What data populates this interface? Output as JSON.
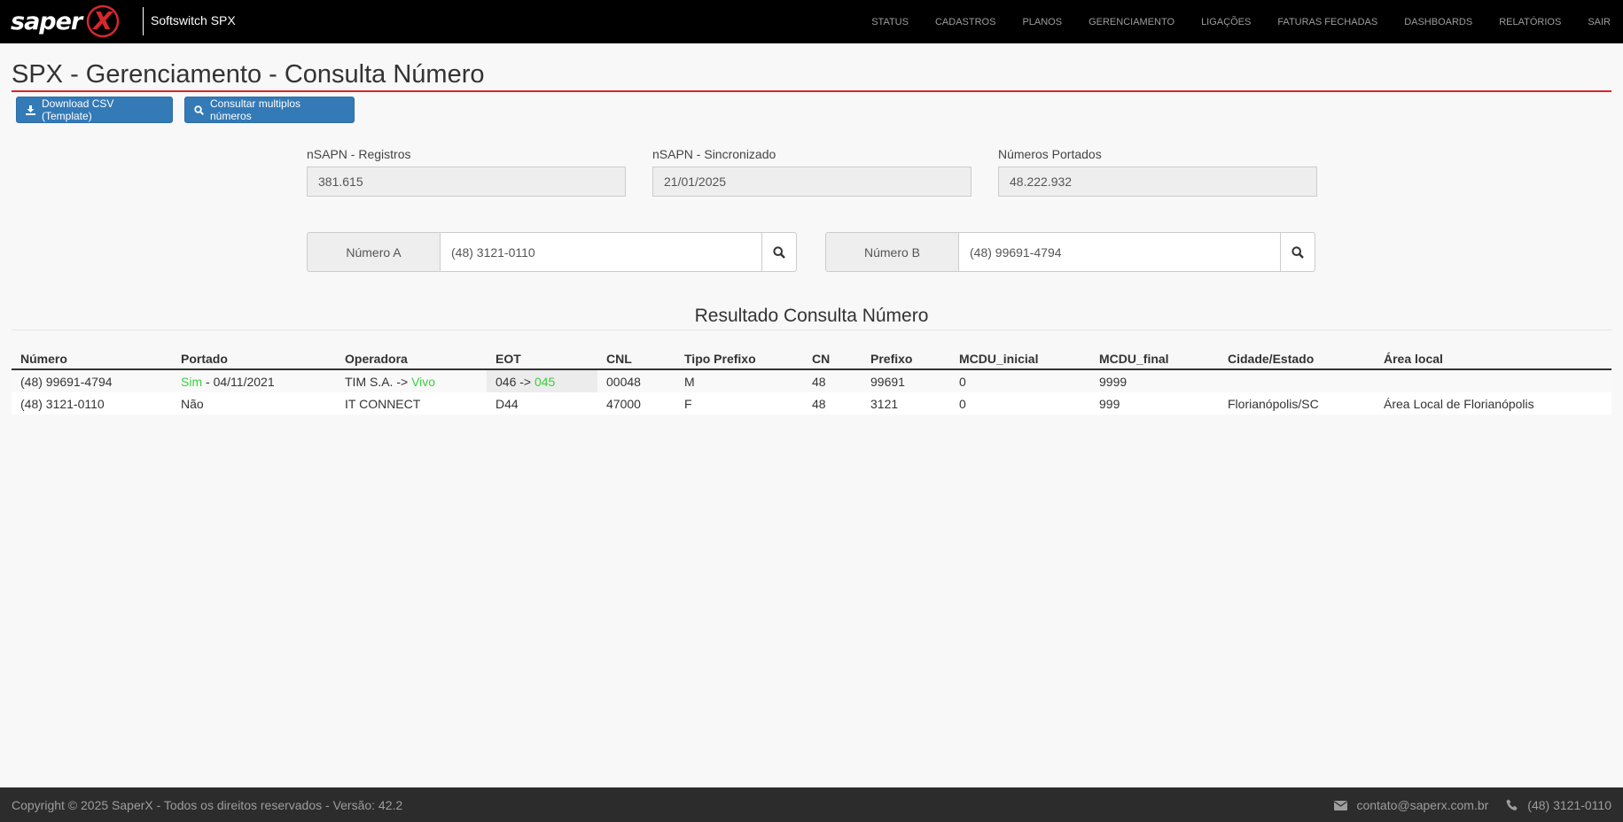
{
  "nav": {
    "logo_text": "saper",
    "logo_mark": "X",
    "brand": "Softswitch SPX",
    "items": [
      "STATUS",
      "CADASTROS",
      "PLANOS",
      "GERENCIAMENTO",
      "LIGAÇÕES",
      "FATURAS FECHADAS",
      "DASHBOARDS",
      "RELATÓRIOS",
      "SAIR"
    ]
  },
  "page": {
    "title": "SPX - Gerenciamento - Consulta Número",
    "accent_color": "#d9262d"
  },
  "buttons": {
    "download_csv": "Download CSV (Template)",
    "consultar_multiplos": "Consultar multiplos números"
  },
  "stats": {
    "registros_label": "nSAPN - Registros",
    "registros_value": "381.615",
    "sincronizado_label": "nSAPN - Sincronizado",
    "sincronizado_value": "21/01/2025",
    "portados_label": "Números Portados",
    "portados_value": "48.222.932"
  },
  "search": {
    "a_label": "Número A",
    "a_value": "(48) 3121-0110",
    "b_label": "Número B",
    "b_value": "(48) 99691-4794"
  },
  "results": {
    "title": "Resultado Consulta Número",
    "headers": [
      "Número",
      "Portado",
      "Operadora",
      "EOT",
      "CNL",
      "Tipo Prefixo",
      "CN",
      "Prefixo",
      "MCDU_inicial",
      "MCDU_final",
      "Cidade/Estado",
      "Área local"
    ],
    "rows": [
      {
        "numero": "(48) 99691-4794",
        "portado_flag": "Sim",
        "portado_sep": " - ",
        "portado_date": "04/11/2021",
        "operadora_from": "TIM S.A. -> ",
        "operadora_to": "Vivo",
        "eot_from": "046 -> ",
        "eot_to": "045",
        "cnl": "00048",
        "tipo_prefixo": "M",
        "cn": "48",
        "prefixo": "99691",
        "mcdu_inicial": "0",
        "mcdu_final": "9999",
        "cidade_estado": "",
        "area_local": ""
      },
      {
        "numero": "(48) 3121-0110",
        "portado": "Não",
        "operadora": "IT CONNECT",
        "eot": "D44",
        "cnl": "47000",
        "tipo_prefixo": "F",
        "cn": "48",
        "prefixo": "3121",
        "mcdu_inicial": "0",
        "mcdu_final": "999",
        "cidade_estado": "Florianópolis/SC",
        "area_local": "Área Local de Florianópolis"
      }
    ]
  },
  "footer": {
    "copyright": "Copyright © 2025 SaperX - Todos os direitos reservados - Versão: 42.2",
    "email": "contato@saperx.com.br",
    "phone": "(48) 3121-0110"
  }
}
